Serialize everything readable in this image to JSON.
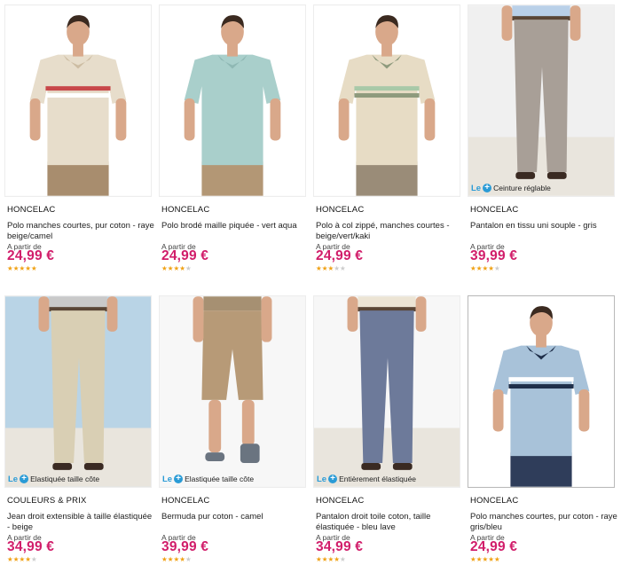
{
  "colors": {
    "price": "#d11d6a",
    "badge_accent": "#2a9bd6",
    "star": "#f0a216"
  },
  "products": [
    {
      "brand": "HONCELAC",
      "title": "Polo manches courtes, pur coton - raye beige/camel",
      "from_label": "A partir de",
      "price": "24,99 €",
      "rating": 5,
      "rating_max": 5,
      "badge": null,
      "photo": {
        "kind": "shirt",
        "shirt": "#e7ddcb",
        "collar": "#cdbda3",
        "pants": "#a88d6e",
        "stripes": [
          "#c8474a",
          "#ffffff"
        ]
      }
    },
    {
      "brand": "HONCELAC",
      "title": "Polo brodé maille piquée - vert aqua",
      "from_label": "A partir de",
      "price": "24,99 €",
      "rating": 4,
      "rating_max": 5,
      "badge": null,
      "photo": {
        "kind": "shirt",
        "shirt": "#a9cfcb",
        "collar": "#8fb8b4",
        "pants": "#b39775",
        "stripes": []
      }
    },
    {
      "brand": "HONCELAC",
      "title": "Polo à col zippé, manches courtes - beige/vert/kaki",
      "from_label": "A partir de",
      "price": "24,99 €",
      "rating": 3,
      "rating_max": 5,
      "badge": null,
      "photo": {
        "kind": "shirt",
        "shirt": "#e7dcc5",
        "collar": "#8e9a7d",
        "pants": "#9a8c78",
        "stripes": [
          "#a8c9a8",
          "#8e9a7d"
        ]
      }
    },
    {
      "brand": "HONCELAC",
      "title": "Pantalon en tissu uni souple - gris",
      "from_label": "A partir de",
      "price": "39,99 €",
      "rating": 4,
      "rating_max": 5,
      "badge": {
        "le": "Le",
        "text": "Ceinture réglable"
      },
      "photo": {
        "kind": "pants",
        "pants": "#a89f97",
        "top": "#b9d0e8",
        "bg": "#f0f0f0"
      }
    },
    {
      "brand": "COULEURS & PRIX",
      "title": "Jean droit extensible à taille élastiquée - beige",
      "from_label": "A partir de",
      "price": "34,99 €",
      "rating": 4,
      "rating_max": 5,
      "badge": {
        "le": "Le",
        "text": "Elastiquée taille côte"
      },
      "photo": {
        "kind": "pants",
        "pants": "#d9cfb4",
        "top": "#c9c9c9",
        "bg": "#b9d4e6"
      }
    },
    {
      "brand": "HONCELAC",
      "title": "Bermuda pur coton - camel",
      "from_label": "A partir de",
      "price": "39,99 €",
      "rating": 4,
      "rating_max": 5,
      "badge": {
        "le": "Le",
        "text": "Elastiquée taille côte"
      },
      "photo": {
        "kind": "shorts",
        "pants": "#b79a77",
        "top": "#a69072",
        "bg": "#f7f7f7"
      }
    },
    {
      "brand": "HONCELAC",
      "title": "Pantalon droit toile coton, taille élastiquée - bleu lave",
      "from_label": "A partir de",
      "price": "34,99 €",
      "rating": 4,
      "rating_max": 5,
      "badge": {
        "le": "Le",
        "text": "Entièrement élastiquée"
      },
      "photo": {
        "kind": "pants",
        "pants": "#6d7a9a",
        "top": "#ece4d4",
        "bg": "#f7f7f7"
      }
    },
    {
      "brand": "HONCELAC",
      "title": "Polo manches courtes, pur coton - raye gris/bleu",
      "from_label": "A partir de",
      "price": "24,99 €",
      "rating": 5,
      "rating_max": 5,
      "badge": null,
      "photo": {
        "kind": "shirt",
        "shirt": "#a8c2d9",
        "collar": "#1f2f4a",
        "pants": "#2f3d5a",
        "stripes": [
          "#ffffff",
          "#1f2f4a"
        ]
      }
    }
  ]
}
